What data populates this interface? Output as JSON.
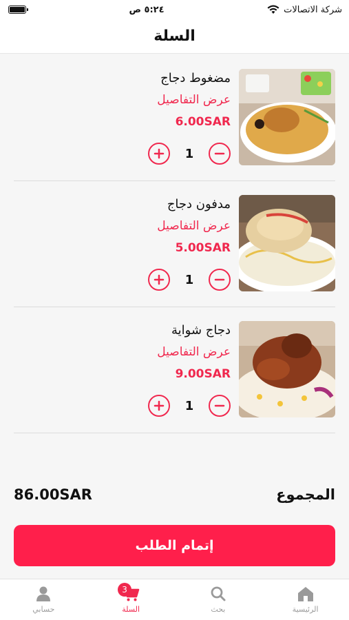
{
  "status_bar": {
    "time": "٥:٢٤ ص",
    "carrier": "شركة الاتصالات",
    "battery_level": 1.0
  },
  "header": {
    "title": "السلة"
  },
  "cart": {
    "items": [
      {
        "name": "مضغوط دجاج",
        "details_label": "عرض التفاصيل",
        "price": "6.00SAR",
        "quantity": "1",
        "image": "chicken-rice-plate"
      },
      {
        "name": "مدفون دجاج",
        "details_label": "عرض التفاصيل",
        "price": "5.00SAR",
        "quantity": "1",
        "image": "chicken-white-rice-plate"
      },
      {
        "name": "دجاج شواية",
        "details_label": "عرض التفاصيل",
        "price": "9.00SAR",
        "quantity": "1",
        "image": "grilled-chicken-rice-plate"
      }
    ]
  },
  "summary": {
    "total_label": "المجموع",
    "total_amount": "86.00SAR"
  },
  "checkout": {
    "label": "إتمام الطلب"
  },
  "tab_bar": {
    "tabs": [
      {
        "label": "حسابي",
        "icon": "person-icon"
      },
      {
        "label": "السلة",
        "icon": "cart-icon",
        "badge": "3",
        "active": true
      },
      {
        "label": "بحث",
        "icon": "search-icon"
      },
      {
        "label": "الرئيسية",
        "icon": "home-icon"
      }
    ]
  },
  "colors": {
    "accent": "#f0284e",
    "checkout": "#ff1f4b",
    "inactive_tab": "#9a9a9a"
  }
}
